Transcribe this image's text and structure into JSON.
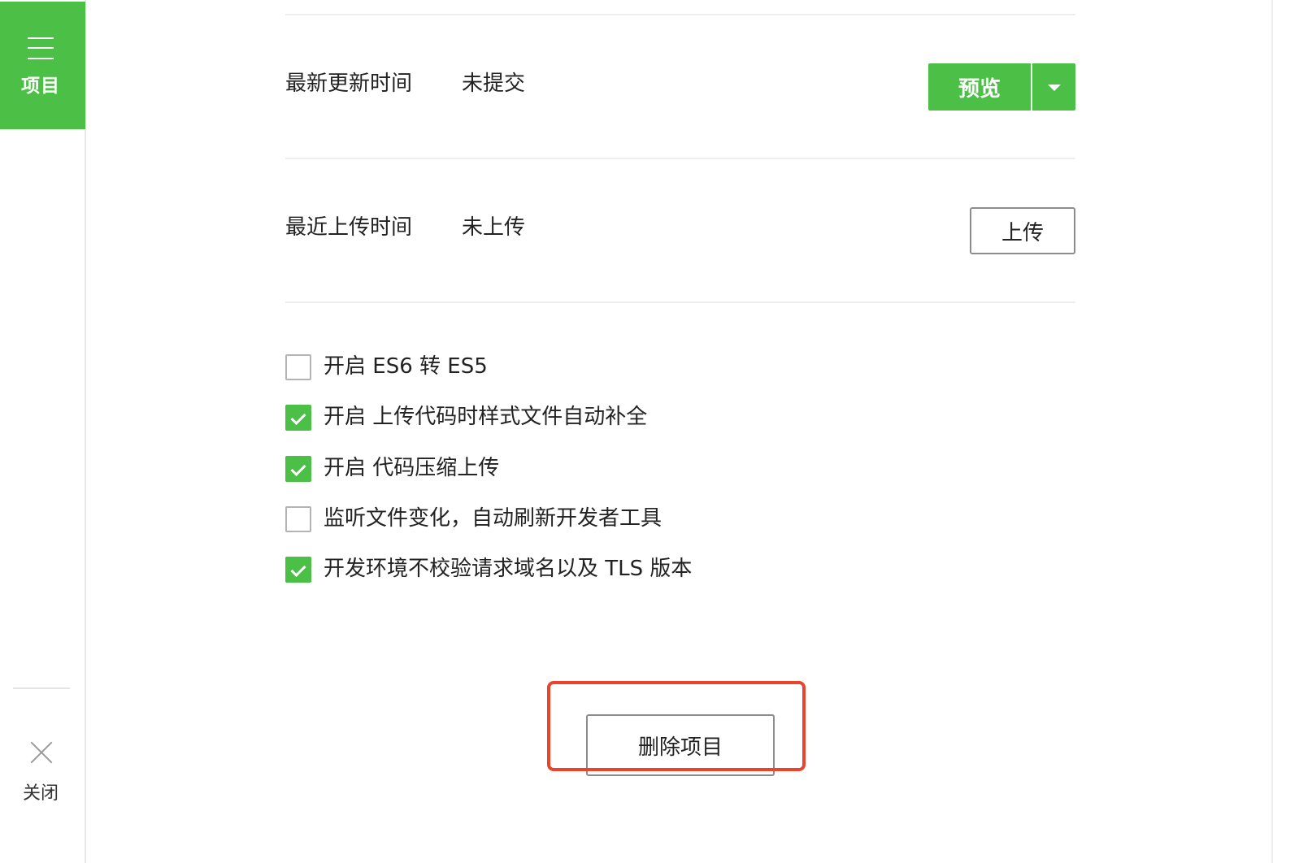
{
  "sidebar": {
    "project": {
      "label": "项目",
      "icon": "menu-icon"
    },
    "close": {
      "label": "关闭",
      "icon": "close-icon"
    }
  },
  "main": {
    "latest_update": {
      "label": "最新更新时间",
      "value": "未提交",
      "preview_label": "预览"
    },
    "latest_upload": {
      "label": "最近上传时间",
      "value": "未上传",
      "upload_label": "上传"
    },
    "options": [
      {
        "label": "开启 ES6 转 ES5",
        "checked": false
      },
      {
        "label": "开启 上传代码时样式文件自动补全",
        "checked": true
      },
      {
        "label": "开启 代码压缩上传",
        "checked": true
      },
      {
        "label": "监听文件变化，自动刷新开发者工具",
        "checked": false
      },
      {
        "label": "开发环境不校验请求域名以及 TLS 版本",
        "checked": true
      }
    ],
    "delete_label": "删除项目"
  },
  "colors": {
    "accent": "#4bbf46",
    "highlight": "#e8452c"
  }
}
